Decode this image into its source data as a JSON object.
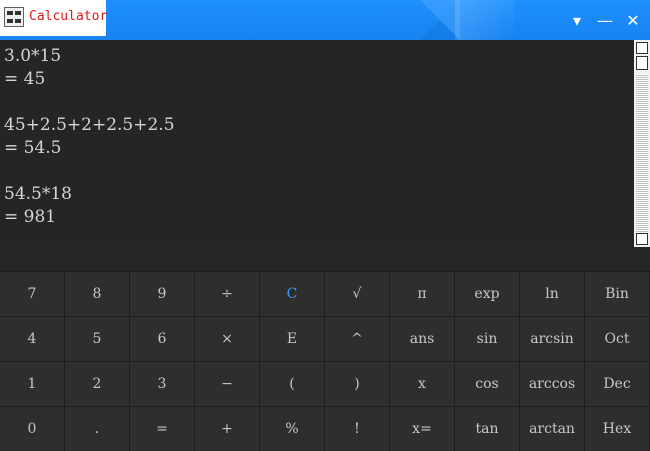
{
  "window": {
    "title": "Calculator"
  },
  "titlebar": {
    "dropdown_icon": "▾",
    "minimize_icon": "—",
    "close_icon": "✕"
  },
  "history": [
    {
      "expr": "3.0*15",
      "result": "= 45"
    },
    {
      "expr": "45+2.5+2+2.5+2.5",
      "result": "= 54.5"
    },
    {
      "expr": "54.5*18",
      "result": "= 981"
    }
  ],
  "keys": [
    [
      "7",
      "8",
      "9",
      "÷",
      "C",
      "√",
      "π",
      "exp",
      "ln",
      "Bin"
    ],
    [
      "4",
      "5",
      "6",
      "×",
      "E",
      "^",
      "ans",
      "sin",
      "arcsin",
      "Oct"
    ],
    [
      "1",
      "2",
      "3",
      "−",
      "(",
      ")",
      "x",
      "cos",
      "arccos",
      "Dec"
    ],
    [
      "0",
      ".",
      "=",
      "+",
      "%",
      "!",
      "x=",
      "tan",
      "arctan",
      "Hex"
    ]
  ],
  "colors": {
    "titlebar": "#1e90ff",
    "title_text": "#e01818",
    "accent_key": "#3aa0ff",
    "display_bg": "#252525",
    "key_bg": "#2e2e2e"
  }
}
